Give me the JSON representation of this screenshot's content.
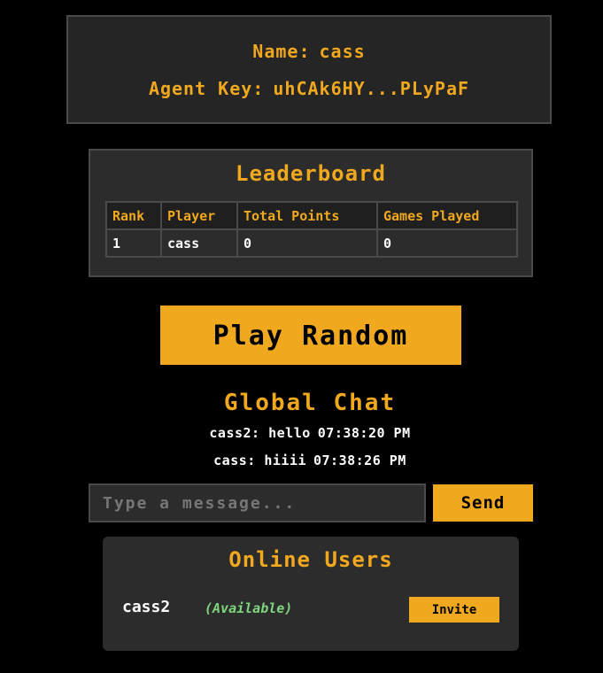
{
  "profile": {
    "name_label": "Name:",
    "name_value": "cass",
    "key_label": "Agent Key:",
    "key_value": "uhCAk6HY...PLyPaF"
  },
  "leaderboard": {
    "title": "Leaderboard",
    "columns": [
      "Rank",
      "Player",
      "Total Points",
      "Games Played"
    ],
    "rows": [
      [
        "1",
        "cass",
        "0",
        "0"
      ]
    ]
  },
  "play_button": "Play Random",
  "chat": {
    "title": "Global Chat",
    "messages": [
      {
        "text": "cass2: hello",
        "time": "07:38:20 PM"
      },
      {
        "text": "cass: hiiii",
        "time": "07:38:26 PM"
      }
    ],
    "input_placeholder": "Type a message...",
    "input_value": "",
    "send_label": "Send"
  },
  "online_users": {
    "title": "Online Users",
    "users": [
      {
        "name": "cass2",
        "status": "(Available)",
        "action": "Invite"
      }
    ]
  },
  "colors": {
    "accent": "#f0a81e",
    "background": "#000000",
    "panel": "#2c2c2c",
    "status_available": "#7fd67f"
  }
}
